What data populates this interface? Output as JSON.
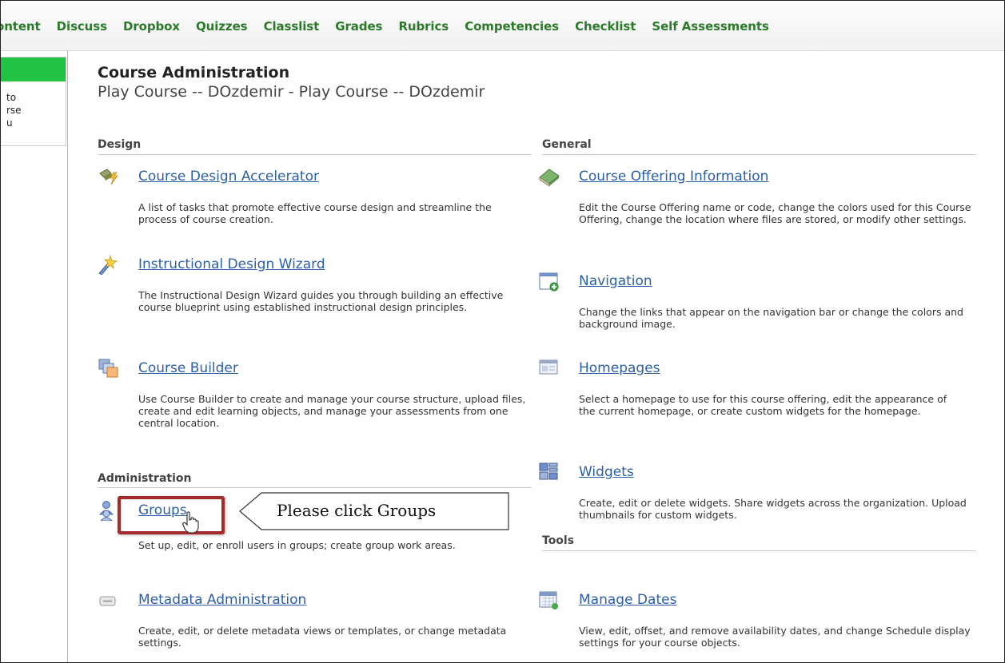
{
  "nav": {
    "items": [
      "ontent",
      "Discuss",
      "Dropbox",
      "Quizzes",
      "Classlist",
      "Grades",
      "Rubrics",
      "Competencies",
      "Checklist",
      "Self Assessments"
    ]
  },
  "left_panel": {
    "lines": [
      "to",
      "rse",
      "u"
    ]
  },
  "header": {
    "title": "Course Administration",
    "subtitle": "Play Course -- DOzdemir - Play Course -- DOzdemir"
  },
  "sections": {
    "design": "Design",
    "general": "General",
    "administration": "Administration",
    "tools": "Tools"
  },
  "tools": {
    "cda": {
      "label": "Course Design Accelerator",
      "desc": "A list of tasks that promote effective course design and streamline the process of course creation.",
      "icon": "wrench-lightning-icon"
    },
    "idw": {
      "label": "Instructional Design Wizard",
      "desc": "The Instructional Design Wizard guides you through building an effective course blueprint using established instructional design principles.",
      "icon": "wand-icon"
    },
    "cb": {
      "label": "Course Builder",
      "desc": "Use Course Builder to create and manage your course structure, upload files, create and edit learning objects, and manage your assessments from one central location.",
      "icon": "stacked-pages-icon"
    },
    "groups": {
      "label": "Groups",
      "desc": "Set up, edit, or enroll users in groups; create group work areas.",
      "icon": "users-icon"
    },
    "meta": {
      "label": "Metadata Administration",
      "desc": "Create, edit, or delete metadata views or templates, or change metadata settings.",
      "icon": "tag-icon"
    },
    "coi": {
      "label": "Course Offering Information",
      "desc": "Edit the Course Offering name or code, change the colors used for this Course Offering, change the location where files are stored, or modify other settings.",
      "icon": "book-icon"
    },
    "nav": {
      "label": "Navigation",
      "desc": "Change the links that appear on the navigation bar or change the colors and background image.",
      "icon": "window-plus-icon"
    },
    "home": {
      "label": "Homepages",
      "desc": "Select a homepage to use for this course offering, edit the appearance of the current homepage, or create custom widgets for the homepage.",
      "icon": "homepage-icon"
    },
    "widgets": {
      "label": "Widgets",
      "desc": "Create, edit or delete widgets. Share widgets across the organization. Upload thumbnails for custom widgets.",
      "icon": "widgets-icon"
    },
    "dates": {
      "label": "Manage Dates",
      "desc": "View, edit, offset, and remove availability dates, and change Schedule display settings for your course objects.",
      "icon": "calendar-icon"
    }
  },
  "callout": {
    "text": "Please click Groups"
  },
  "colors": {
    "nav_green": "#2a7a2a",
    "link_blue": "#2b5fa8",
    "highlight": "#a52a2a",
    "panel_green": "#22c244"
  }
}
